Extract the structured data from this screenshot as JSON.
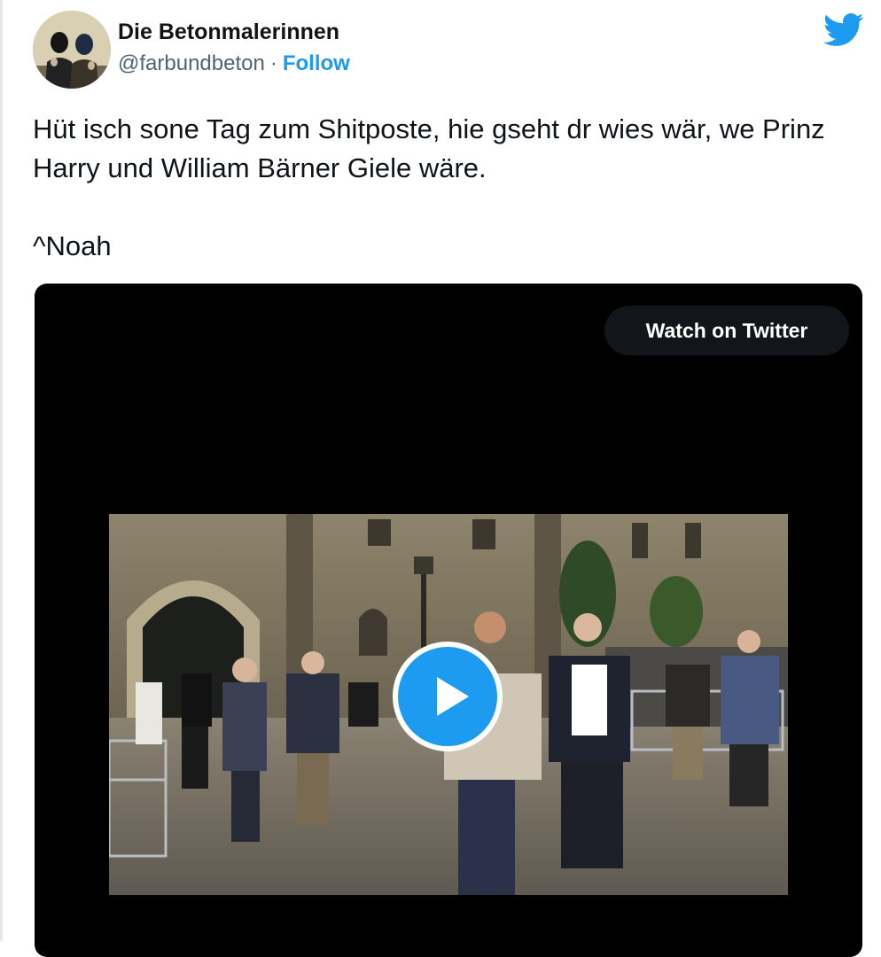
{
  "author": {
    "name": "Die Betonmalerinnen",
    "handle": "@farbundbeton",
    "separator": "·",
    "follow_label": "Follow",
    "avatar_icon": "avatar-photo"
  },
  "brand": {
    "icon": "twitter-bird-icon",
    "color": "#1d9bf0"
  },
  "tweet": {
    "text": "Hüt isch sone Tag zum Shitposte, hie gseht dr wies wär, we Prinz Harry und William Bärner Giele wäre.",
    "signature": "^Noah"
  },
  "media": {
    "watch_label": "Watch on Twitter",
    "play_icon": "play-icon",
    "accent": "#1d9bf0"
  }
}
